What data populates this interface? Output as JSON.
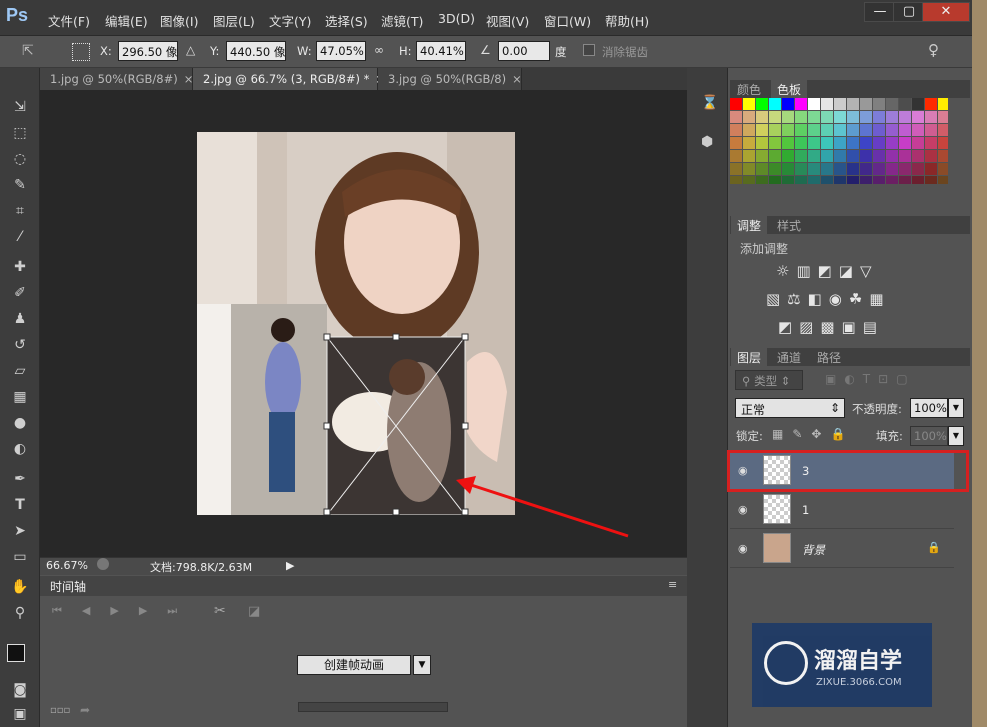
{
  "app": {
    "logo": "Ps"
  },
  "menu": [
    "文件(F)",
    "编辑(E)",
    "图像(I)",
    "图层(L)",
    "文字(Y)",
    "选择(S)",
    "滤镜(T)",
    "3D(D)",
    "视图(V)",
    "窗口(W)",
    "帮助(H)"
  ],
  "window_buttons": {
    "min": "—",
    "max": "▢",
    "close": "✕"
  },
  "options": {
    "x_label": "X:",
    "x_value": "296.50 像",
    "y_label": "Y:",
    "y_value": "440.50 像",
    "w_label": "W:",
    "w_value": "47.05%",
    "h_label": "H:",
    "h_value": "40.41%",
    "angle_value": "0.00",
    "angle_unit": "度",
    "antialias_label": "消除锯齿"
  },
  "tabs": [
    "1.jpg @ 50%(RGB/8#)",
    "2.jpg @ 66.7% (3, RGB/8#) *",
    "3.jpg @ 50%(RGB/8)"
  ],
  "status": {
    "zoom": "66.67%",
    "doc": "文档:798.8K/2.63M"
  },
  "timeline": {
    "title": "时间轴",
    "create_button": "创建帧动画"
  },
  "panels": {
    "color_tabs": [
      "颜色",
      "色板"
    ],
    "adjust_tabs": [
      "调整",
      "样式"
    ],
    "add_adjust": "添加调整",
    "layer_tabs": [
      "图层",
      "通道",
      "路径"
    ],
    "filter_kind": "类型",
    "blend_mode": "正常",
    "opacity_label": "不透明度:",
    "opacity_value": "100%",
    "lock_label": "锁定:",
    "fill_label": "填充:",
    "fill_value": "100%"
  },
  "layers": [
    {
      "name": "3",
      "selected": true
    },
    {
      "name": "1",
      "selected": false
    },
    {
      "name": "背景",
      "selected": false
    }
  ],
  "watermark": {
    "title": "溜溜自学",
    "url": "ZIXUE.3066.COM"
  },
  "swatch_colors": [
    "#ff0000",
    "#ffff00",
    "#00ff00",
    "#00ffff",
    "#0000ff",
    "#ff00ff",
    "#ffffff",
    "#e6e6e6",
    "#cccccc",
    "#b3b3b3",
    "#999999",
    "#808080",
    "#666666",
    "#4d4d4d",
    "#333333",
    "#ff2a00",
    "#ffee00"
  ]
}
